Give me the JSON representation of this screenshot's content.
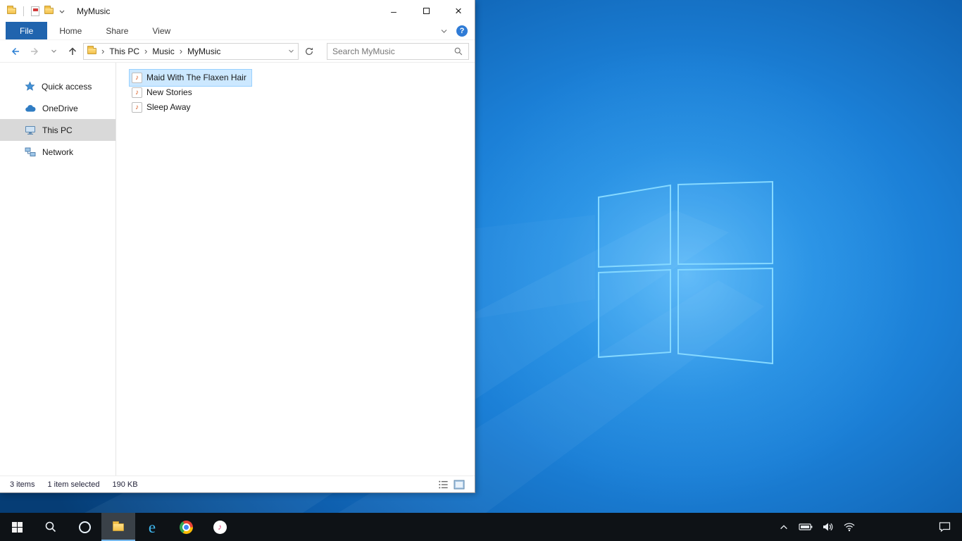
{
  "explorer": {
    "titlebar": {
      "title": "MyMusic"
    },
    "ribbon": {
      "tabs": [
        {
          "label": "File"
        },
        {
          "label": "Home"
        },
        {
          "label": "Share"
        },
        {
          "label": "View"
        }
      ]
    },
    "navbar": {
      "breadcrumb": [
        "This PC",
        "Music",
        "MyMusic"
      ],
      "search_placeholder": "Search MyMusic"
    },
    "sidebar": [
      {
        "label": "Quick access"
      },
      {
        "label": "OneDrive"
      },
      {
        "label": "This PC"
      },
      {
        "label": "Network"
      }
    ],
    "files": [
      {
        "name": "Maid With The Flaxen Hair"
      },
      {
        "name": "New Stories"
      },
      {
        "name": "Sleep Away"
      }
    ],
    "statusbar": {
      "count": "3 items",
      "selected": "1 item selected",
      "size": "190 KB"
    }
  },
  "taskbar": {
    "ie_glyph": "e"
  },
  "glyphs": {
    "chevron_right": "›",
    "minimize": "–",
    "close": "×",
    "help": "?",
    "music_note": "♪"
  },
  "colors": {
    "accent_blue": "#2064ae",
    "selection_blue": "#cce8ff",
    "selection_border": "#99d1ff",
    "folder_yellow": "#f3c14a",
    "taskbar_black": "#0e1216"
  }
}
